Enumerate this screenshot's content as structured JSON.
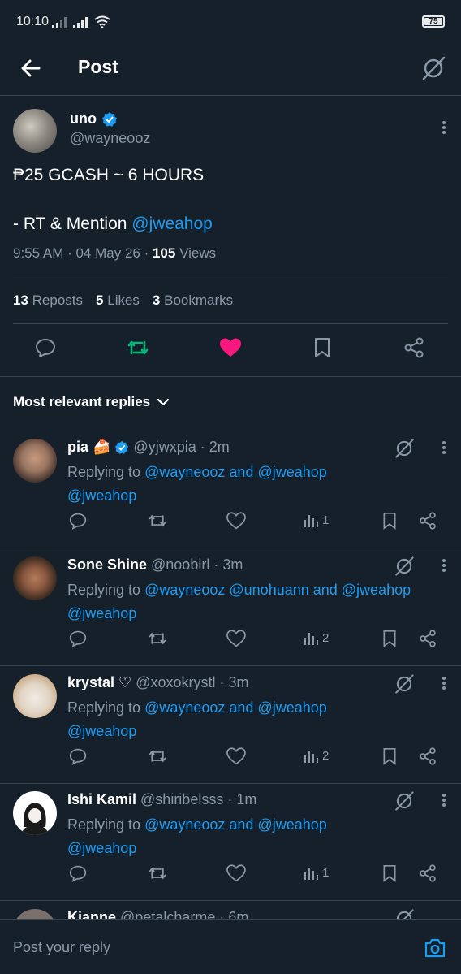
{
  "status_bar": {
    "time": "10:10",
    "battery": "75"
  },
  "header": {
    "title": "Post"
  },
  "post": {
    "name": "uno",
    "handle": "@wayneooz",
    "line1": "₱25 GCASH ~ 6 HOURS",
    "line2_prefix": "- RT & Mention ",
    "line2_mention": "@jweahop",
    "time": "9:55 AM · 04 May 26 · ",
    "views_count": "105",
    "views_label": " Views"
  },
  "stats": {
    "reposts_count": "13",
    "reposts_label": "Reposts",
    "likes_count": "5",
    "likes_label": "Likes",
    "bookmarks_count": "3",
    "bookmarks_label": "Bookmarks"
  },
  "sort": {
    "label": "Most relevant replies"
  },
  "replies": [
    {
      "name": "pia 🍰",
      "handle": "@yjwxpia · 2m",
      "prefix": "Replying to ",
      "mentions1": "@wayneooz and @jweahop",
      "mentions2": "@jweahop",
      "views": "1"
    },
    {
      "name": "Sone Shine",
      "handle": "@noobirl · 3m",
      "prefix": "Replying to ",
      "mentions1": "@wayneooz @unohuann and @jweahop",
      "mentions2": "@jweahop",
      "views": "2"
    },
    {
      "name": "krystal ♡",
      "handle": "@xoxokrystl · 3m",
      "prefix": "Replying to ",
      "mentions1": "@wayneooz and @jweahop",
      "mentions2": "@jweahop",
      "views": "2"
    },
    {
      "name": "Ishi Kamil",
      "handle": "@shiribelsss · 1m",
      "prefix": "Replying to ",
      "mentions1": "@wayneooz and @jweahop",
      "mentions2": "@jweahop",
      "views": "1"
    }
  ],
  "partial_reply": {
    "name": "Kianne",
    "handle": "@petalcharme · 6m"
  },
  "composer": {
    "placeholder": "Post your reply"
  },
  "colors": {
    "bg": "#15202b",
    "accent": "#1d9bf0",
    "repost": "#00ba7c",
    "like": "#f91880",
    "muted": "#8b98a5"
  }
}
